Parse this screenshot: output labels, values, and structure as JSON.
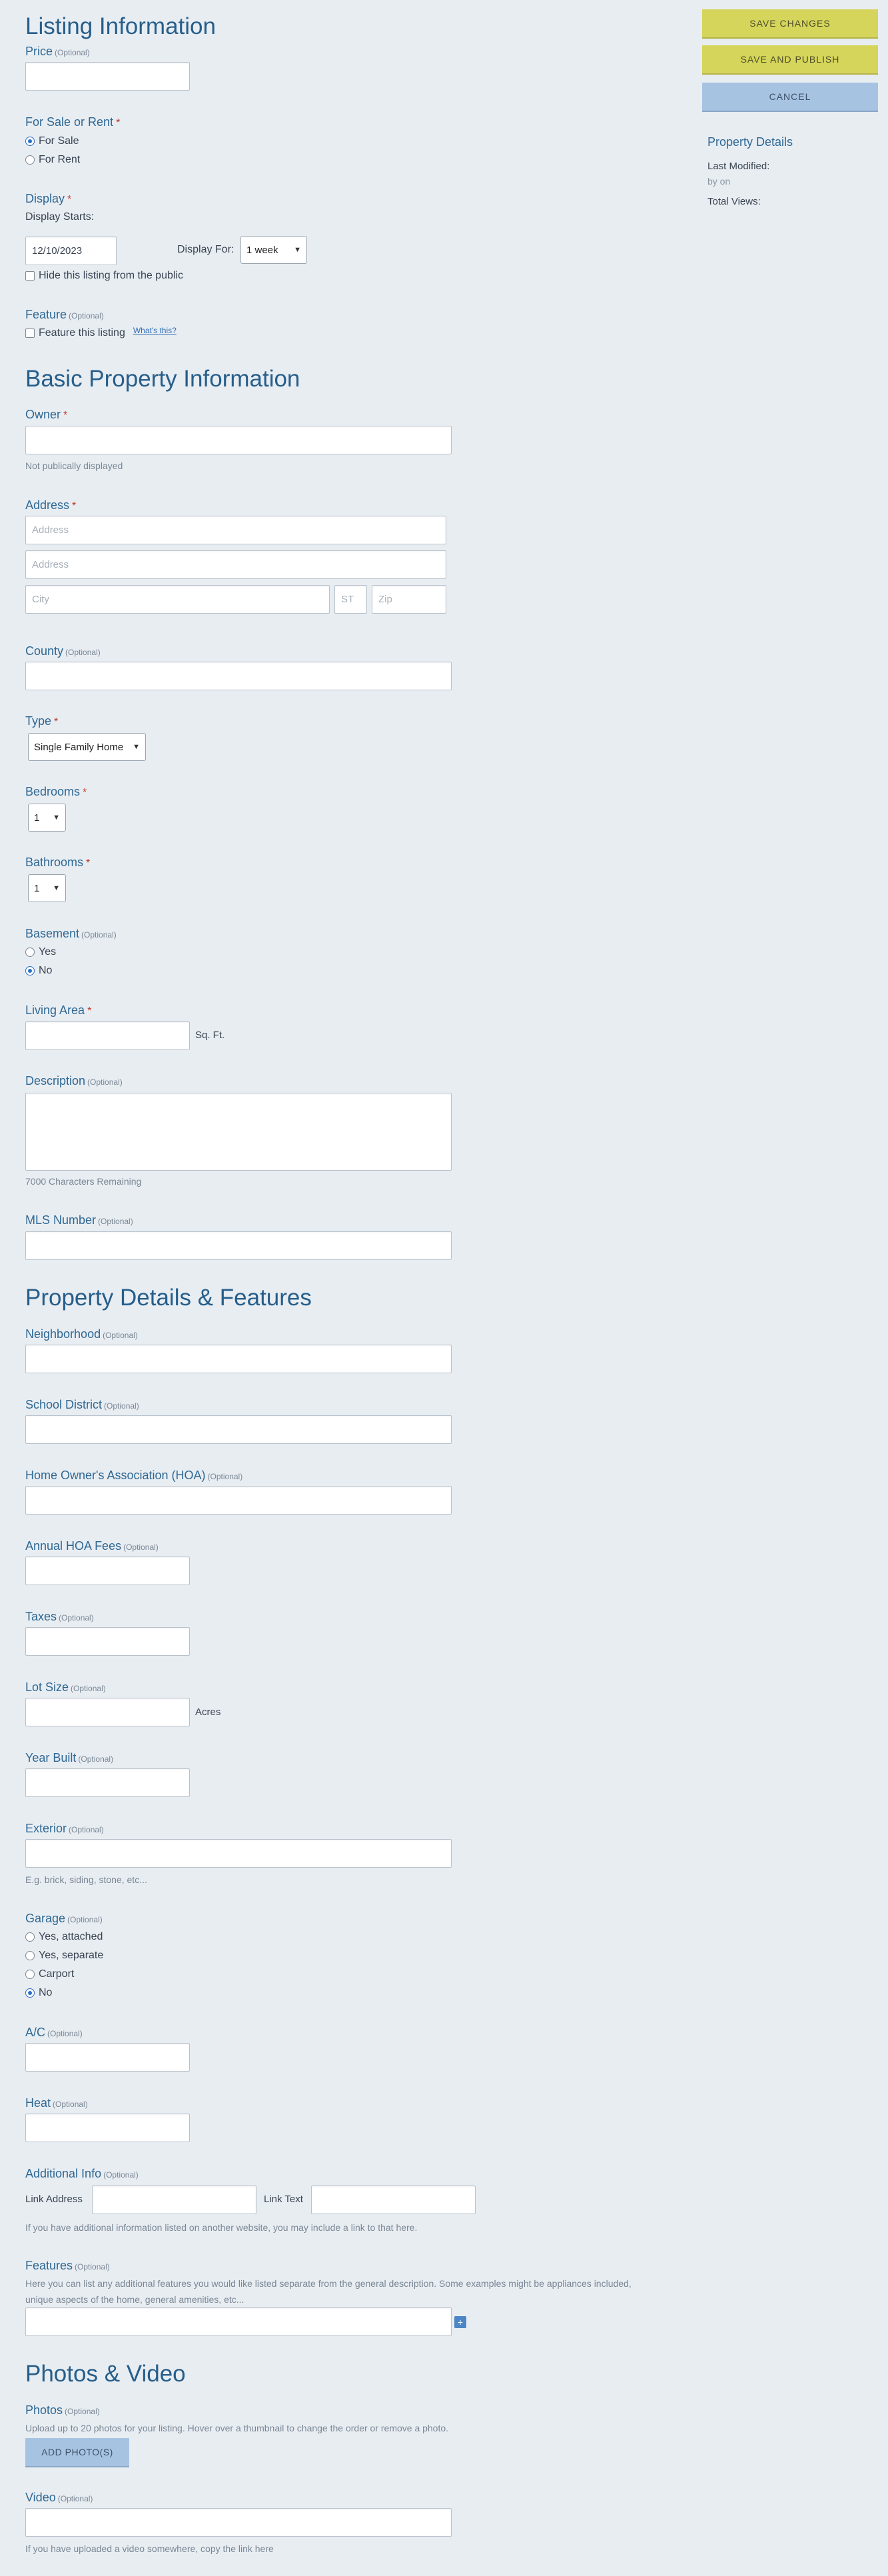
{
  "listing": {
    "title": "Listing Information",
    "price": {
      "label": "Price",
      "optional": "(Optional)",
      "value": ""
    },
    "sale_rent": {
      "label": "For Sale or Rent",
      "required": "*",
      "options": [
        "For Sale",
        "For Rent"
      ],
      "selected": "For Sale"
    },
    "display": {
      "label": "Display",
      "required": "*",
      "starts_label": "Display Starts:",
      "start_date": "12/10/2023",
      "for_label": "Display For:",
      "for_value": "1 week",
      "hide_label": "Hide this listing from the public"
    },
    "feature": {
      "label": "Feature",
      "optional": "(Optional)",
      "checkbox_label": "Feature this listing",
      "whats_this": "What's this?"
    }
  },
  "sidebar": {
    "save_changes": "SAVE CHANGES",
    "save_publish": "SAVE AND PUBLISH",
    "cancel": "CANCEL",
    "details_title": "Property Details",
    "last_modified_label": "Last Modified:",
    "last_modified_by": "by on",
    "total_views_label": "Total Views:"
  },
  "basic": {
    "title": "Basic Property Information",
    "owner": {
      "label": "Owner",
      "required": "*",
      "value": "",
      "hint": "Not publically displayed"
    },
    "address": {
      "label": "Address",
      "required": "*",
      "line1_placeholder": "Address",
      "line2_placeholder": "Address",
      "city_placeholder": "City",
      "state_placeholder": "ST",
      "zip_placeholder": "Zip"
    },
    "county": {
      "label": "County",
      "optional": "(Optional)",
      "value": ""
    },
    "type": {
      "label": "Type",
      "required": "*",
      "value": "Single Family Home"
    },
    "bedrooms": {
      "label": "Bedrooms",
      "required": "*",
      "value": "1"
    },
    "bathrooms": {
      "label": "Bathrooms",
      "required": "*",
      "value": "1"
    },
    "basement": {
      "label": "Basement",
      "optional": "(Optional)",
      "options": [
        "Yes",
        "No"
      ],
      "selected": "No"
    },
    "living_area": {
      "label": "Living Area",
      "required": "*",
      "value": "",
      "unit": "Sq. Ft."
    },
    "description": {
      "label": "Description",
      "optional": "(Optional)",
      "value": "",
      "hint": "7000 Characters Remaining"
    },
    "mls": {
      "label": "MLS Number",
      "optional": "(Optional)",
      "value": ""
    }
  },
  "details": {
    "title": "Property Details & Features",
    "neighborhood": {
      "label": "Neighborhood",
      "optional": "(Optional)"
    },
    "school": {
      "label": "School District",
      "optional": "(Optional)"
    },
    "hoa": {
      "label": "Home Owner's Association (HOA)",
      "optional": "(Optional)"
    },
    "hoa_fees": {
      "label": "Annual HOA Fees",
      "optional": "(Optional)"
    },
    "taxes": {
      "label": "Taxes",
      "optional": "(Optional)"
    },
    "lot_size": {
      "label": "Lot Size",
      "optional": "(Optional)",
      "unit": "Acres"
    },
    "year_built": {
      "label": "Year Built",
      "optional": "(Optional)"
    },
    "exterior": {
      "label": "Exterior",
      "optional": "(Optional)",
      "hint": "E.g. brick, siding, stone, etc..."
    },
    "garage": {
      "label": "Garage",
      "optional": "(Optional)",
      "options": [
        "Yes, attached",
        "Yes, separate",
        "Carport",
        "No"
      ],
      "selected": "No"
    },
    "ac": {
      "label": "A/C",
      "optional": "(Optional)"
    },
    "heat": {
      "label": "Heat",
      "optional": "(Optional)"
    },
    "additional": {
      "label": "Additional Info",
      "optional": "(Optional)",
      "link_address_label": "Link Address",
      "link_text_label": "Link Text",
      "hint": "If you have additional information listed on another website, you may include a link to that here."
    },
    "features": {
      "label": "Features",
      "optional": "(Optional)",
      "hint1": "Here you can list any additional features you would like listed separate from the general description. Some examples might be appliances included,",
      "hint2": "unique aspects of the home, general amenities, etc...",
      "add_symbol": "+"
    }
  },
  "media": {
    "title": "Photos & Video",
    "photos": {
      "label": "Photos",
      "optional": "(Optional)",
      "hint": "Upload up to 20 photos for your listing. Hover over a thumbnail to change the order or remove a photo.",
      "button": "ADD PHOTO(S)"
    },
    "video": {
      "label": "Video",
      "optional": "(Optional)",
      "hint": "If you have uploaded a video somewhere, copy the link here"
    }
  }
}
